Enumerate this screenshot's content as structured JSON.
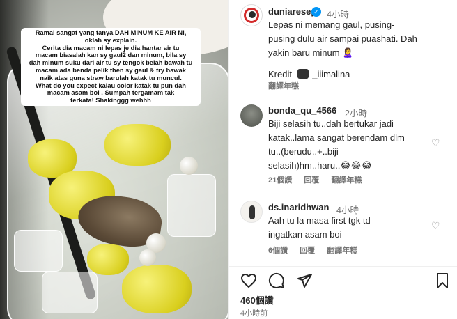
{
  "media": {
    "caption_lines": [
      "Ramai sangat yang tanya DAH MINUM KE AIR NI,",
      "oklah sy explain.",
      "Cerita dia macam ni lepas je dia hantar air tu",
      "macam biasalah kan sy gaul2 dan minum, bila sy",
      "dah minum suku dari air tu sy tengok belah bawah tu",
      "macam ada benda pelik then sy gaul & try bawak",
      "naik atas guna straw barulah katak tu muncul.",
      "What do you expect kalau color katak tu pun dah",
      "macam asam boi . Sumpah tergamam tak",
      "terkata! Shakinggg wehhh"
    ]
  },
  "post": {
    "author": "duniaresepi",
    "time": "4小時",
    "caption": "Lepas ni memang gaul, pusing-pusing dulu air sampai puashati. Dah yakin baru minum 🙎‍♀️",
    "caption_lines": [
      "Lepas ni memang gaul, pusing-",
      "pusing dulu air sampai puashati. Dah",
      "yakin baru minum 🙎‍♀️"
    ],
    "credit_label": "Kredit",
    "credit_user": "_iiimalina",
    "see_translation": "翻譯年糕"
  },
  "comments": [
    {
      "user": "bonda_qu_4566",
      "time": "2小時",
      "lines": [
        "Biji selasih tu..dah bertukar jadi",
        "katak..lama sangat berendam dlm",
        "tu..(berudu..+..biji",
        "selasih)hm..haru..😂😂😂"
      ],
      "likes": "21個讚",
      "reply": "回覆",
      "translate": "翻譯年糕"
    },
    {
      "user": "ds.inaridhwan",
      "time": "4小時",
      "lines": [
        "Aah tu la masa first tgk td",
        "ingatkan asam boi"
      ],
      "likes": "6個讚",
      "reply": "回覆",
      "translate": "翻譯年糕"
    }
  ],
  "actions": {
    "like_icon": "heart-icon",
    "comment_icon": "comment-icon",
    "share_icon": "share-icon",
    "save_icon": "bookmark-icon"
  },
  "likes_count": "460個讚",
  "posted_ago": "4小時前",
  "colors": {
    "verified": "#0095f6",
    "text": "#262626",
    "muted": "#737373"
  }
}
